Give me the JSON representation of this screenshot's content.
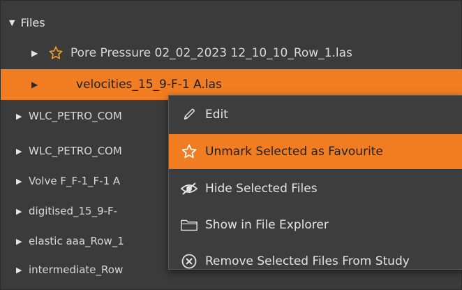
{
  "tree": {
    "header": {
      "expand_glyph": "▼",
      "label": "Files"
    },
    "rows": [
      {
        "label": "Pore Pressure 02_02_2023 12_10_10_Row_1.las",
        "favourite": true,
        "selected": false
      },
      {
        "label": "velocities_15_9-F-1 A.las",
        "favourite": false,
        "selected": true
      },
      {
        "label": "WLC_PETRO_COM",
        "favourite": false,
        "selected": false
      },
      {
        "label": "WLC_PETRO_COM",
        "favourite": false,
        "selected": false
      },
      {
        "label": "Volve F_F-1_F-1 A",
        "favourite": false,
        "selected": false
      },
      {
        "label": "digitised_15_9-F-",
        "favourite": false,
        "selected": false
      },
      {
        "label": "elastic aaa_Row_1",
        "favourite": false,
        "selected": false
      },
      {
        "label": "intermediate_Row",
        "favourite": false,
        "selected": false
      }
    ]
  },
  "context_menu": {
    "items": [
      {
        "label": "Edit",
        "icon": "pencil-icon",
        "active": false
      },
      {
        "label": "Unmark Selected as Favourite",
        "icon": "star-outline-icon",
        "active": true
      },
      {
        "label": "Hide Selected Files",
        "icon": "eye-hidden-icon",
        "active": false
      },
      {
        "label": "Show in File Explorer",
        "icon": "folder-icon",
        "active": false
      },
      {
        "label": "Remove Selected Files From Study",
        "icon": "circle-x-icon",
        "active": false
      }
    ]
  },
  "colors": {
    "panel_bg": "#3b3b3b",
    "accent_orange": "#f07d22",
    "text": "#e4e4e4",
    "star": "#f0a020"
  }
}
